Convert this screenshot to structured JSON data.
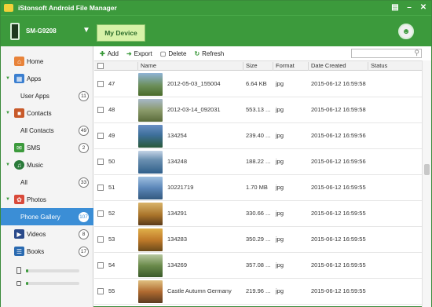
{
  "window": {
    "title": "iStonsoft Android File Manager"
  },
  "device": {
    "name": "SM-G9208",
    "my_device_label": "My Device"
  },
  "sidebar": {
    "home": "Home",
    "apps": "Apps",
    "user_apps": {
      "label": "User Apps",
      "count": "11"
    },
    "contacts": "Contacts",
    "all_contacts": {
      "label": "All Contacts",
      "count": "49"
    },
    "sms": {
      "label": "SMS",
      "count": "2"
    },
    "music": "Music",
    "music_all": {
      "label": "All",
      "count": "33"
    },
    "photos": "Photos",
    "phone_gallery": {
      "label": "Phone Gallery",
      "count": "107"
    },
    "videos": {
      "label": "Videos",
      "count": "8"
    },
    "books": {
      "label": "Books",
      "count": "17"
    },
    "storage": [
      {
        "kind": "phone",
        "used_fraction": 0.04
      },
      {
        "kind": "sd-card",
        "used_fraction": 0.04
      }
    ]
  },
  "toolbar": {
    "add": "Add",
    "export": "Export",
    "delete": "Delete",
    "refresh": "Refresh",
    "search_value": ""
  },
  "table": {
    "columns": [
      "Name",
      "Size",
      "Format",
      "Date Created",
      "Status"
    ],
    "rows": [
      {
        "num": "47",
        "name": "2012-05-03_155004",
        "size": "6.64 KB",
        "format": "jpg",
        "date": "2015-06-12 16:59:58",
        "status": ""
      },
      {
        "num": "48",
        "name": "2012-03-14_092031",
        "size": "553.13 ...",
        "format": "jpg",
        "date": "2015-06-12 16:59:58",
        "status": ""
      },
      {
        "num": "49",
        "name": "134254",
        "size": "239.40 ...",
        "format": "jpg",
        "date": "2015-06-12 16:59:56",
        "status": ""
      },
      {
        "num": "50",
        "name": "134248",
        "size": "188.22 ...",
        "format": "jpg",
        "date": "2015-06-12 16:59:56",
        "status": ""
      },
      {
        "num": "51",
        "name": "10221719",
        "size": "1.70 MB",
        "format": "jpg",
        "date": "2015-06-12 16:59:55",
        "status": ""
      },
      {
        "num": "52",
        "name": "134291",
        "size": "330.66 ...",
        "format": "jpg",
        "date": "2015-06-12 16:59:55",
        "status": ""
      },
      {
        "num": "53",
        "name": "134283",
        "size": "350.29 ...",
        "format": "jpg",
        "date": "2015-06-12 16:59:55",
        "status": ""
      },
      {
        "num": "54",
        "name": "134269",
        "size": "357.08 ...",
        "format": "jpg",
        "date": "2015-06-12 16:59:55",
        "status": ""
      },
      {
        "num": "55",
        "name": "Castle Autumn Germany",
        "size": "219.96 ...",
        "format": "jpg",
        "date": "2015-06-12 16:59:55",
        "status": ""
      }
    ]
  },
  "colors": {
    "brand_green": "#3c9a3c",
    "selection_blue": "#3b8ed6",
    "device_button": "#d7f2a8"
  }
}
